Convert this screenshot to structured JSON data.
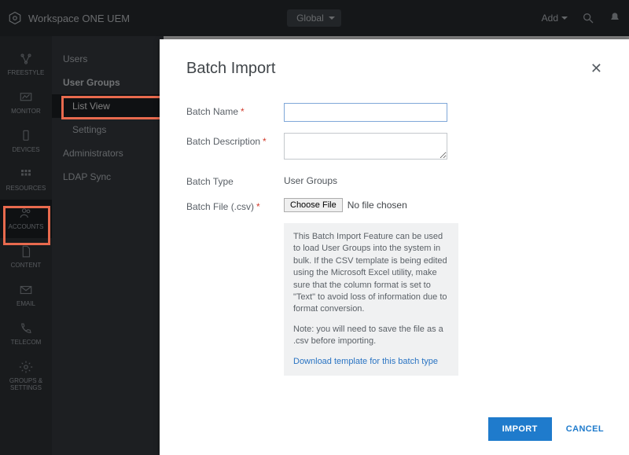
{
  "header": {
    "brand": "Workspace ONE UEM",
    "og": "Global",
    "add": "Add"
  },
  "rail": {
    "items": [
      {
        "label": "FREESTYLE"
      },
      {
        "label": "MONITOR"
      },
      {
        "label": "DEVICES"
      },
      {
        "label": "RESOURCES"
      },
      {
        "label": "ACCOUNTS"
      },
      {
        "label": "CONTENT"
      },
      {
        "label": "EMAIL"
      },
      {
        "label": "TELECOM"
      },
      {
        "label": "GROUPS & SETTINGS"
      }
    ]
  },
  "secnav": {
    "items": [
      {
        "label": "Users"
      },
      {
        "label": "User Groups"
      },
      {
        "label": "List View"
      },
      {
        "label": "Settings"
      },
      {
        "label": "Administrators"
      },
      {
        "label": "LDAP Sync"
      }
    ]
  },
  "modal": {
    "title": "Batch Import",
    "labels": {
      "batch_name": "Batch Name",
      "batch_desc": "Batch Description",
      "batch_type": "Batch Type",
      "batch_file": "Batch File (.csv)"
    },
    "batch_type_value": "User Groups",
    "file_button": "Choose File",
    "file_status": "No file chosen",
    "info_p1": "This Batch Import Feature can be used to load User Groups into the system in bulk. If the CSV template is being edited using the Microsoft Excel utility, make sure that the column format is set to \"Text\" to avoid loss of information due to format conversion.",
    "info_p2": "Note: you will need to save the file as a .csv before importing.",
    "download_link": "Download template for this batch type",
    "import_btn": "IMPORT",
    "cancel_btn": "CANCEL"
  }
}
